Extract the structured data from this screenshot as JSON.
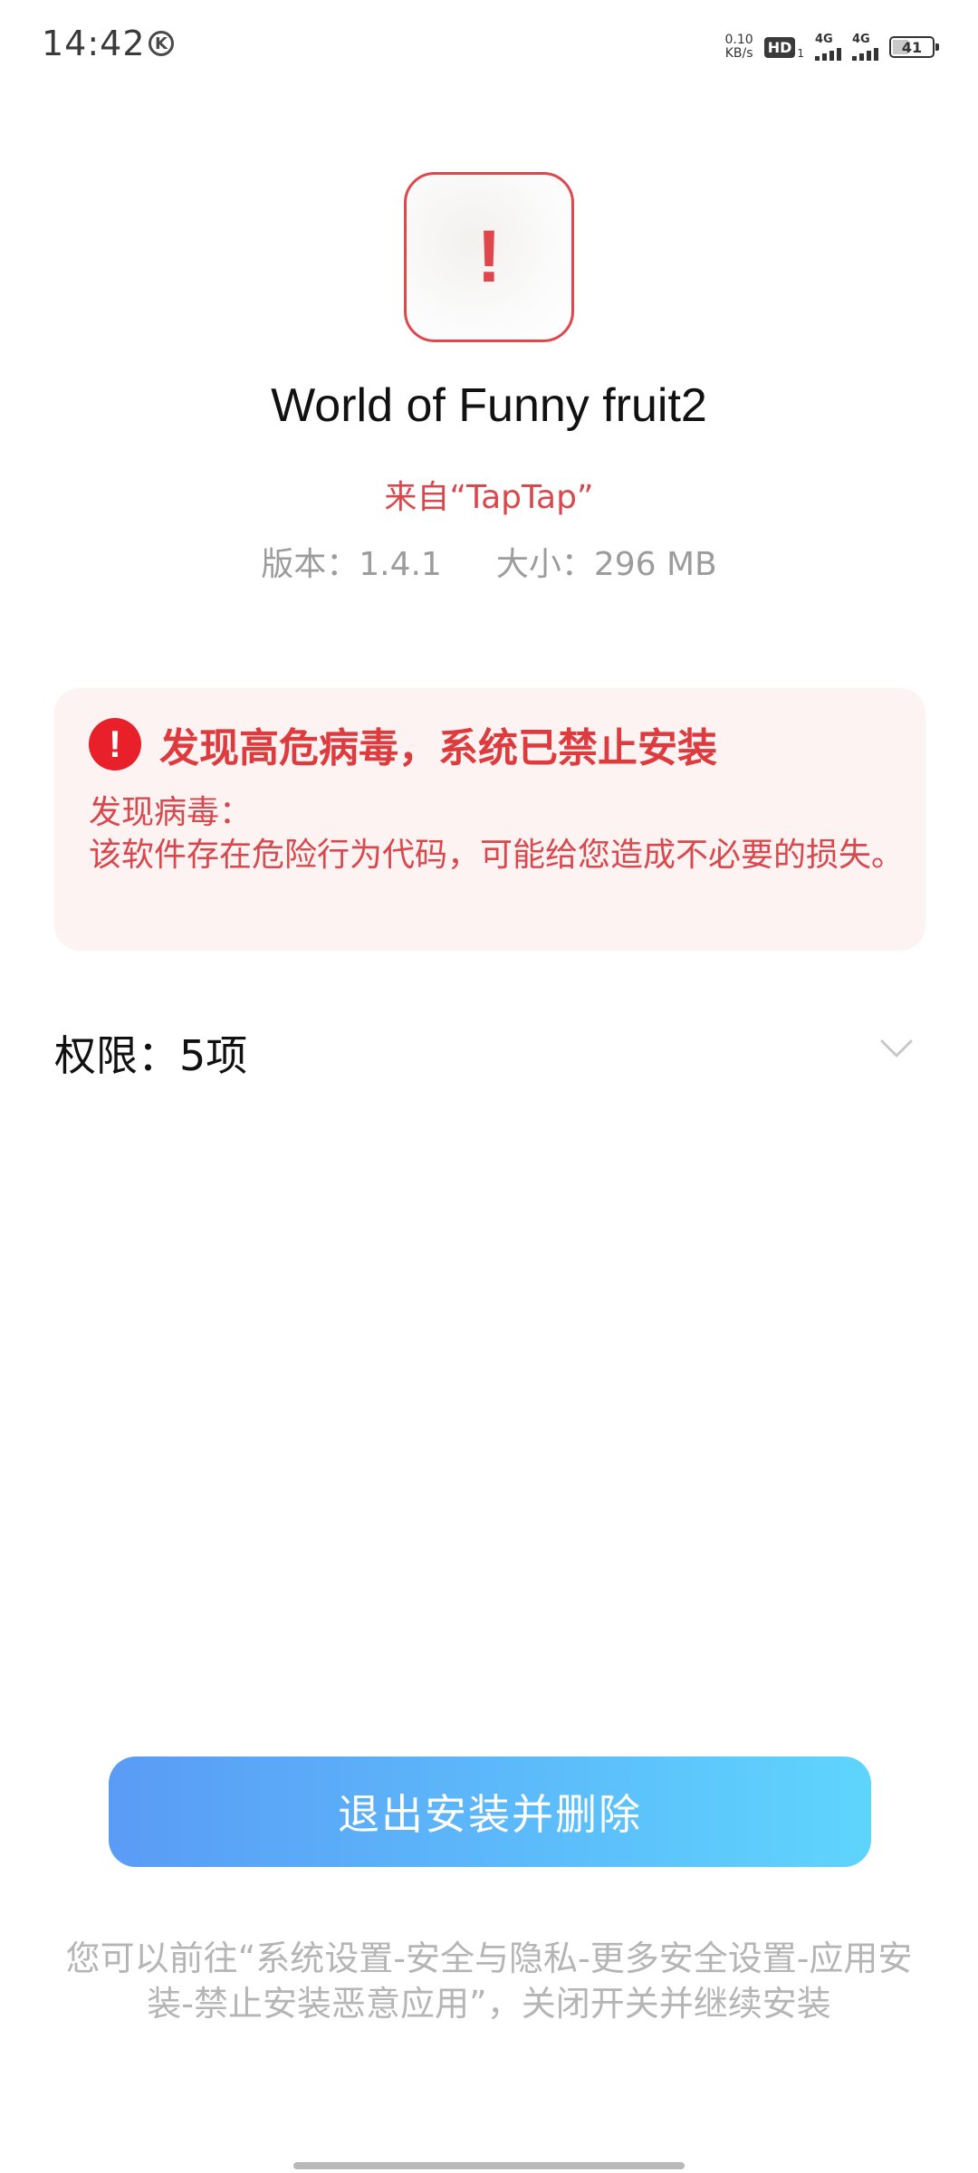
{
  "status_bar": {
    "time": "14:42",
    "k_icon": "K",
    "net_speed_value": "0.10",
    "net_speed_unit": "KB/s",
    "hd": "HD",
    "hd_sub": "1",
    "signal1_label": "4G",
    "signal2_label": "4G",
    "battery": "41",
    "battery_level_percent": 41
  },
  "app": {
    "icon": "warning-exclamation",
    "icon_glyph": "!",
    "name": "World of Funny fruit2",
    "source": "来自“TapTap”",
    "version": "版本：1.4.1",
    "size": "大小：296 MB"
  },
  "warning": {
    "icon_glyph": "!",
    "title": "发现高危病毒，系统已禁止安装",
    "body_line1": "发现病毒：",
    "body_line2": "该软件存在危险行为代码，可能给您造成不必要的损失。",
    "accent_color": "#de3b3f"
  },
  "permissions": {
    "label": "权限：5项",
    "icon": "chevron-down-icon"
  },
  "actions": {
    "exit_delete_label": "退出安装并删除"
  },
  "hint": {
    "text": "您可以前往“系统设置-安全与隐私-更多安全设置-应用安装-禁止安装恶意应用”，关闭开关并继续安装"
  }
}
